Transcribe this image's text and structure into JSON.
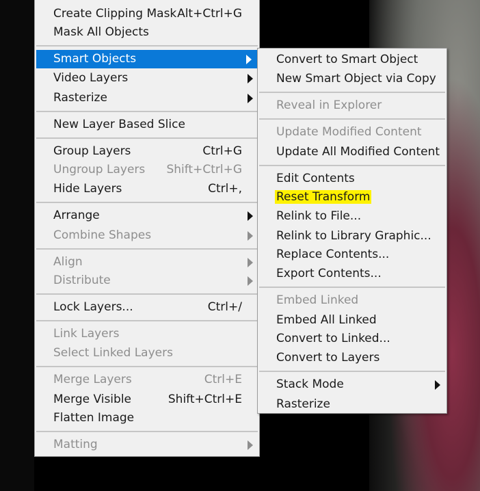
{
  "main_menu": {
    "items": [
      {
        "label": "Create Clipping Mask",
        "shortcut": "Alt+Ctrl+G"
      },
      {
        "label": "Mask All Objects"
      },
      {
        "label": "Smart Objects"
      },
      {
        "label": "Video Layers"
      },
      {
        "label": "Rasterize"
      },
      {
        "label": "New Layer Based Slice"
      },
      {
        "label": "Group Layers",
        "shortcut": "Ctrl+G"
      },
      {
        "label": "Ungroup Layers",
        "shortcut": "Shift+Ctrl+G"
      },
      {
        "label": "Hide Layers",
        "shortcut": "Ctrl+,"
      },
      {
        "label": "Arrange"
      },
      {
        "label": "Combine Shapes"
      },
      {
        "label": "Align"
      },
      {
        "label": "Distribute"
      },
      {
        "label": "Lock Layers...",
        "shortcut": "Ctrl+/"
      },
      {
        "label": "Link Layers"
      },
      {
        "label": "Select Linked Layers"
      },
      {
        "label": "Merge Layers",
        "shortcut": "Ctrl+E"
      },
      {
        "label": "Merge Visible",
        "shortcut": "Shift+Ctrl+E"
      },
      {
        "label": "Flatten Image"
      },
      {
        "label": "Matting"
      }
    ]
  },
  "smart_objects_submenu": {
    "items": [
      {
        "label": "Convert to Smart Object"
      },
      {
        "label": "New Smart Object via Copy"
      },
      {
        "label": "Reveal in Explorer"
      },
      {
        "label": "Update Modified Content"
      },
      {
        "label": "Update All Modified Content"
      },
      {
        "label": "Edit Contents"
      },
      {
        "label": "Reset Transform"
      },
      {
        "label": "Relink to File..."
      },
      {
        "label": "Relink to Library Graphic..."
      },
      {
        "label": "Replace Contents..."
      },
      {
        "label": "Export Contents..."
      },
      {
        "label": "Embed Linked"
      },
      {
        "label": "Embed All Linked"
      },
      {
        "label": "Convert to Linked..."
      },
      {
        "label": "Convert to Layers"
      },
      {
        "label": "Stack Mode"
      },
      {
        "label": "Rasterize"
      }
    ]
  },
  "colors": {
    "menu_background": "#f0f0f0",
    "selection": "#0a79d8",
    "highlight": "#fff200",
    "disabled_text": "#8e8e8e"
  }
}
